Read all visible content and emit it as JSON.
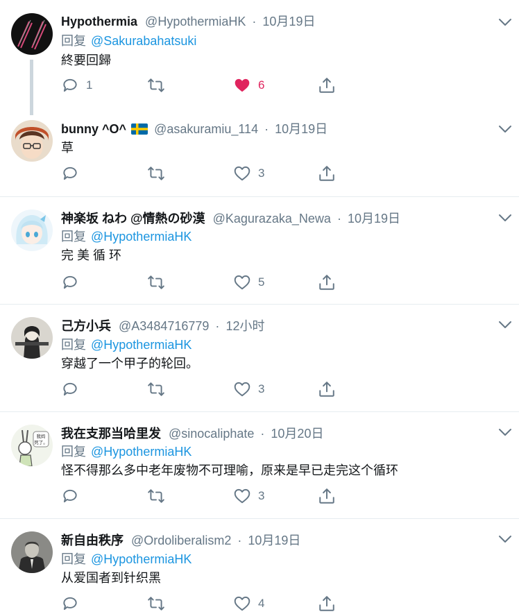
{
  "tweets": [
    {
      "name": "Hypothermia",
      "handle": "@HypothermiaHK",
      "time": "10月19日",
      "reply_label": "回复",
      "reply_to": "@Sakurabahatsuki",
      "text": "終要回歸",
      "replies": "1",
      "retweets": "",
      "likes": "6",
      "liked": true
    },
    {
      "name": "bunny ^O^",
      "flag": "sweden-flag-icon",
      "handle": "@asakuramiu_114",
      "time": "10月19日",
      "text": "草",
      "replies": "",
      "retweets": "",
      "likes": "3"
    },
    {
      "name": "神楽坂 ねわ @情熱の砂漠",
      "handle": "@Kagurazaka_Newa",
      "time": "10月19日",
      "reply_label": "回复",
      "reply_to": "@HypothermiaHK",
      "text": "完 美 循 环",
      "replies": "",
      "retweets": "",
      "likes": "5"
    },
    {
      "name": "己方小兵",
      "handle": "@A3484716779",
      "time": "12小时",
      "reply_label": "回复",
      "reply_to": "@HypothermiaHK",
      "text": "穿越了一个甲子的轮回。",
      "replies": "",
      "retweets": "",
      "likes": "3"
    },
    {
      "name": "我在支那当哈里发",
      "handle": "@sinocaliphate",
      "time": "10月20日",
      "reply_label": "回复",
      "reply_to": "@HypothermiaHK",
      "text": "怪不得那么多中老年废物不可理喻，原来是早已走完这个循环",
      "replies": "",
      "retweets": "",
      "likes": "3"
    },
    {
      "name": "新自由秩序",
      "handle": "@Ordoliberalism2",
      "time": "10月19日",
      "reply_label": "回复",
      "reply_to": "@HypothermiaHK",
      "text": "从爱国者到针织黑",
      "replies": "",
      "retweets": "",
      "likes": "4"
    }
  ],
  "separator": "·",
  "avatar_art": {
    "t5_caption": "我妈死了。"
  },
  "colors": {
    "like_active": "#e0245e",
    "mention": "#1b95e0",
    "muted": "#657786",
    "text": "#14171a",
    "border": "#e6ecf0"
  },
  "icons": {
    "reply": "reply-icon",
    "retweet": "retweet-icon",
    "like": "heart-icon",
    "share": "share-icon",
    "menu": "chevron-down-icon"
  }
}
